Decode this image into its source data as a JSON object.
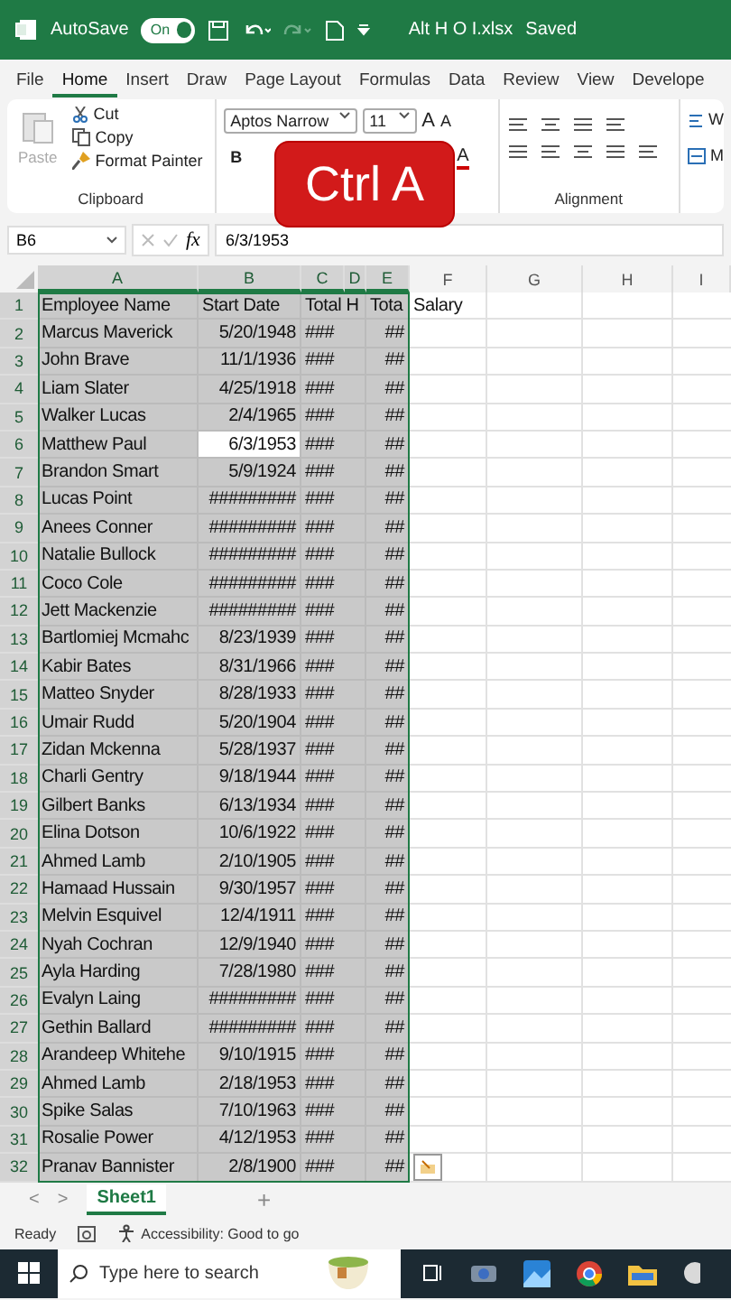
{
  "title_bar": {
    "autosave_label": "AutoSave",
    "autosave": {
      "on": true,
      "label": "On"
    },
    "file_name": "Alt H O I.xlsx",
    "status": "Saved"
  },
  "ribbon_tabs": [
    {
      "label": "File",
      "selected": false
    },
    {
      "label": "Home",
      "selected": true
    },
    {
      "label": "Insert",
      "selected": false
    },
    {
      "label": "Draw",
      "selected": false
    },
    {
      "label": "Page Layout",
      "selected": false
    },
    {
      "label": "Formulas",
      "selected": false
    },
    {
      "label": "Data",
      "selected": false
    },
    {
      "label": "Review",
      "selected": false
    },
    {
      "label": "View",
      "selected": false
    },
    {
      "label": "Develope",
      "selected": false
    }
  ],
  "ribbon": {
    "clipboard": {
      "paste": {
        "label": "Paste",
        "disabled": true
      },
      "cut": "Cut",
      "copy": "Copy",
      "format_painter": "Format Painter",
      "group_label": "Clipboard"
    },
    "font": {
      "name": "Aptos Narrow",
      "size": "11",
      "grow": "A",
      "shrink": "A",
      "bold": "B",
      "color_letter": "A"
    },
    "alignment": {
      "group_label": "Alignment",
      "wrap": "W",
      "merge": "M"
    }
  },
  "overlay_badge": "Ctrl A",
  "formula_bar": {
    "name_box": "B6",
    "fx": "fx",
    "value": "6/3/1953"
  },
  "columns": [
    {
      "label": "A",
      "selected": true
    },
    {
      "label": "B",
      "selected": true
    },
    {
      "label": "C",
      "selected": true
    },
    {
      "label": "D",
      "selected": true
    },
    {
      "label": "E",
      "selected": true
    },
    {
      "label": "F",
      "selected": false
    },
    {
      "label": "G",
      "selected": false
    },
    {
      "label": "H",
      "selected": false
    },
    {
      "label": "I",
      "selected": false
    }
  ],
  "rows": [
    {
      "number": "1",
      "kind": "header",
      "selected": true,
      "cells": [
        {
          "text": "Employee Name",
          "active": false
        },
        {
          "text": "Start Date",
          "active": false
        },
        {
          "text": "Total H",
          "active": false
        },
        {
          "text": "Tota",
          "active": false
        }
      ],
      "f": "Salary"
    },
    {
      "number": "2",
      "kind": "record",
      "selected": true,
      "cells": [
        {
          "text": "Marcus Maverick",
          "active": false
        },
        {
          "text": "5/20/1948",
          "active": false
        },
        {
          "text": "###",
          "active": false
        },
        {
          "text": "##",
          "active": false
        }
      ]
    },
    {
      "number": "3",
      "kind": "record",
      "selected": true,
      "cells": [
        {
          "text": "John Brave",
          "active": false
        },
        {
          "text": "11/1/1936",
          "active": false
        },
        {
          "text": "###",
          "active": false
        },
        {
          "text": "##",
          "active": false
        }
      ]
    },
    {
      "number": "4",
      "kind": "record",
      "selected": true,
      "cells": [
        {
          "text": "Liam Slater",
          "active": false
        },
        {
          "text": "4/25/1918",
          "active": false
        },
        {
          "text": "###",
          "active": false
        },
        {
          "text": "##",
          "active": false
        }
      ]
    },
    {
      "number": "5",
      "kind": "record",
      "selected": true,
      "cells": [
        {
          "text": "Walker Lucas",
          "active": false
        },
        {
          "text": "2/4/1965",
          "active": false
        },
        {
          "text": "###",
          "active": false
        },
        {
          "text": "##",
          "active": false
        }
      ]
    },
    {
      "number": "6",
      "kind": "record",
      "selected": true,
      "cells": [
        {
          "text": "Matthew Paul",
          "active": false
        },
        {
          "text": "6/3/1953",
          "active": true
        },
        {
          "text": "###",
          "active": false
        },
        {
          "text": "##",
          "active": false
        }
      ]
    },
    {
      "number": "7",
      "kind": "record",
      "selected": true,
      "cells": [
        {
          "text": "Brandon Smart",
          "active": false
        },
        {
          "text": "5/9/1924",
          "active": false
        },
        {
          "text": "###",
          "active": false
        },
        {
          "text": "##",
          "active": false
        }
      ]
    },
    {
      "number": "8",
      "kind": "record",
      "selected": true,
      "cells": [
        {
          "text": "Lucas Point",
          "active": false
        },
        {
          "text": "#########",
          "active": false
        },
        {
          "text": "###",
          "active": false
        },
        {
          "text": "##",
          "active": false
        }
      ]
    },
    {
      "number": "9",
      "kind": "record",
      "selected": true,
      "cells": [
        {
          "text": "Anees Conner",
          "active": false
        },
        {
          "text": "#########",
          "active": false
        },
        {
          "text": "###",
          "active": false
        },
        {
          "text": "##",
          "active": false
        }
      ]
    },
    {
      "number": "10",
      "kind": "record",
      "selected": true,
      "cells": [
        {
          "text": "Natalie Bullock",
          "active": false
        },
        {
          "text": "#########",
          "active": false
        },
        {
          "text": "###",
          "active": false
        },
        {
          "text": "##",
          "active": false
        }
      ]
    },
    {
      "number": "11",
      "kind": "record",
      "selected": true,
      "cells": [
        {
          "text": "Coco Cole",
          "active": false
        },
        {
          "text": "#########",
          "active": false
        },
        {
          "text": "###",
          "active": false
        },
        {
          "text": "##",
          "active": false
        }
      ]
    },
    {
      "number": "12",
      "kind": "record",
      "selected": true,
      "cells": [
        {
          "text": "Jett Mackenzie",
          "active": false
        },
        {
          "text": "#########",
          "active": false
        },
        {
          "text": "###",
          "active": false
        },
        {
          "text": "##",
          "active": false
        }
      ]
    },
    {
      "number": "13",
      "kind": "record",
      "selected": true,
      "cells": [
        {
          "text": "Bartlomiej Mcmahc",
          "active": false
        },
        {
          "text": "8/23/1939",
          "active": false
        },
        {
          "text": "###",
          "active": false
        },
        {
          "text": "##",
          "active": false
        }
      ]
    },
    {
      "number": "14",
      "kind": "record",
      "selected": true,
      "cells": [
        {
          "text": "Kabir Bates",
          "active": false
        },
        {
          "text": "8/31/1966",
          "active": false
        },
        {
          "text": "###",
          "active": false
        },
        {
          "text": "##",
          "active": false
        }
      ]
    },
    {
      "number": "15",
      "kind": "record",
      "selected": true,
      "cells": [
        {
          "text": "Matteo Snyder",
          "active": false
        },
        {
          "text": "8/28/1933",
          "active": false
        },
        {
          "text": "###",
          "active": false
        },
        {
          "text": "##",
          "active": false
        }
      ]
    },
    {
      "number": "16",
      "kind": "record",
      "selected": true,
      "cells": [
        {
          "text": "Umair Rudd",
          "active": false
        },
        {
          "text": "5/20/1904",
          "active": false
        },
        {
          "text": "###",
          "active": false
        },
        {
          "text": "##",
          "active": false
        }
      ]
    },
    {
      "number": "17",
      "kind": "record",
      "selected": true,
      "cells": [
        {
          "text": "Zidan Mckenna",
          "active": false
        },
        {
          "text": "5/28/1937",
          "active": false
        },
        {
          "text": "###",
          "active": false
        },
        {
          "text": "##",
          "active": false
        }
      ]
    },
    {
      "number": "18",
      "kind": "record",
      "selected": true,
      "cells": [
        {
          "text": "Charli Gentry",
          "active": false
        },
        {
          "text": "9/18/1944",
          "active": false
        },
        {
          "text": "###",
          "active": false
        },
        {
          "text": "##",
          "active": false
        }
      ]
    },
    {
      "number": "19",
      "kind": "record",
      "selected": true,
      "cells": [
        {
          "text": "Gilbert Banks",
          "active": false
        },
        {
          "text": "6/13/1934",
          "active": false
        },
        {
          "text": "###",
          "active": false
        },
        {
          "text": "##",
          "active": false
        }
      ]
    },
    {
      "number": "20",
      "kind": "record",
      "selected": true,
      "cells": [
        {
          "text": "Elina Dotson",
          "active": false
        },
        {
          "text": "10/6/1922",
          "active": false
        },
        {
          "text": "###",
          "active": false
        },
        {
          "text": "##",
          "active": false
        }
      ]
    },
    {
      "number": "21",
      "kind": "record",
      "selected": true,
      "cells": [
        {
          "text": "Ahmed Lamb",
          "active": false
        },
        {
          "text": "2/10/1905",
          "active": false
        },
        {
          "text": "###",
          "active": false
        },
        {
          "text": "##",
          "active": false
        }
      ]
    },
    {
      "number": "22",
      "kind": "record",
      "selected": true,
      "cells": [
        {
          "text": "Hamaad Hussain",
          "active": false
        },
        {
          "text": "9/30/1957",
          "active": false
        },
        {
          "text": "###",
          "active": false
        },
        {
          "text": "##",
          "active": false
        }
      ]
    },
    {
      "number": "23",
      "kind": "record",
      "selected": true,
      "cells": [
        {
          "text": "Melvin Esquivel",
          "active": false
        },
        {
          "text": "12/4/1911",
          "active": false
        },
        {
          "text": "###",
          "active": false
        },
        {
          "text": "##",
          "active": false
        }
      ]
    },
    {
      "number": "24",
      "kind": "record",
      "selected": true,
      "cells": [
        {
          "text": "Nyah Cochran",
          "active": false
        },
        {
          "text": "12/9/1940",
          "active": false
        },
        {
          "text": "###",
          "active": false
        },
        {
          "text": "##",
          "active": false
        }
      ]
    },
    {
      "number": "25",
      "kind": "record",
      "selected": true,
      "cells": [
        {
          "text": "Ayla Harding",
          "active": false
        },
        {
          "text": "7/28/1980",
          "active": false
        },
        {
          "text": "###",
          "active": false
        },
        {
          "text": "##",
          "active": false
        }
      ]
    },
    {
      "number": "26",
      "kind": "record",
      "selected": true,
      "cells": [
        {
          "text": "Evalyn Laing",
          "active": false
        },
        {
          "text": "#########",
          "active": false
        },
        {
          "text": "###",
          "active": false
        },
        {
          "text": "##",
          "active": false
        }
      ]
    },
    {
      "number": "27",
      "kind": "record",
      "selected": true,
      "cells": [
        {
          "text": "Gethin Ballard",
          "active": false
        },
        {
          "text": "#########",
          "active": false
        },
        {
          "text": "###",
          "active": false
        },
        {
          "text": "##",
          "active": false
        }
      ]
    },
    {
      "number": "28",
      "kind": "record",
      "selected": true,
      "cells": [
        {
          "text": "Arandeep Whitehe",
          "active": false
        },
        {
          "text": "9/10/1915",
          "active": false
        },
        {
          "text": "###",
          "active": false
        },
        {
          "text": "##",
          "active": false
        }
      ]
    },
    {
      "number": "29",
      "kind": "record",
      "selected": true,
      "cells": [
        {
          "text": "Ahmed Lamb",
          "active": false
        },
        {
          "text": "2/18/1953",
          "active": false
        },
        {
          "text": "###",
          "active": false
        },
        {
          "text": "##",
          "active": false
        }
      ]
    },
    {
      "number": "30",
      "kind": "record",
      "selected": true,
      "cells": [
        {
          "text": "Spike Salas",
          "active": false
        },
        {
          "text": "7/10/1963",
          "active": false
        },
        {
          "text": "###",
          "active": false
        },
        {
          "text": "##",
          "active": false
        }
      ]
    },
    {
      "number": "31",
      "kind": "record",
      "selected": true,
      "cells": [
        {
          "text": "Rosalie Power",
          "active": false
        },
        {
          "text": "4/12/1953",
          "active": false
        },
        {
          "text": "###",
          "active": false
        },
        {
          "text": "##",
          "active": false
        }
      ]
    },
    {
      "number": "32",
      "kind": "record",
      "selected": true,
      "cells": [
        {
          "text": "Pranav Bannister",
          "active": false
        },
        {
          "text": "2/8/1900",
          "active": false
        },
        {
          "text": "###",
          "active": false
        },
        {
          "text": "##",
          "active": false
        }
      ]
    }
  ],
  "sheet_tabs": {
    "prev": "<",
    "next": ">",
    "tabs": [
      {
        "label": "Sheet1",
        "selected": true
      }
    ],
    "add": "+"
  },
  "status_bar": {
    "mode": "Ready",
    "accessibility": "Accessibility: Good to go"
  },
  "taskbar": {
    "search_placeholder": "Type here to search"
  }
}
